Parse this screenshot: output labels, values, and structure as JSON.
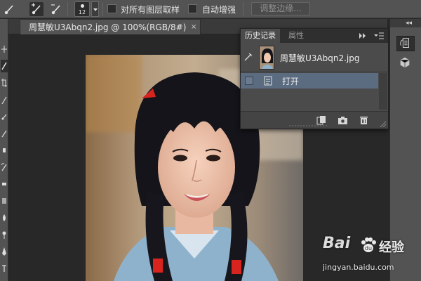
{
  "options_bar": {
    "tool_presets": [
      "brush-tool-icon",
      "brush-tool-plus-icon",
      "brush-tool-minus-icon"
    ],
    "brush_size": "12",
    "sample_all_layers_label": "对所有图层取样",
    "sample_all_layers_checked": false,
    "auto_enhance_label": "自动增强",
    "auto_enhance_checked": false,
    "refine_edge_label": "调整边缘...",
    "refine_edge_enabled": false
  },
  "document": {
    "tab_title": "周慧敏U3Abqn2.jpg @ 100%(RGB/8#)",
    "close_glyph": "×"
  },
  "history_panel": {
    "tabs": [
      {
        "label": "历史记录",
        "active": true
      },
      {
        "label": "属性",
        "active": false
      }
    ],
    "expand_glyph": "▸▸",
    "snapshot_label": "周慧敏U3Abqn2.jpg",
    "states": [
      {
        "label": "打开",
        "selected": true
      }
    ],
    "footer_buttons": [
      "new-document-from-state-icon",
      "camera-icon",
      "trash-icon"
    ]
  },
  "right_dock": {
    "collapse_glyph": "◂◂",
    "buttons": [
      "history-icon",
      "cube-icon"
    ]
  },
  "watermark": {
    "logo_left": "Bai",
    "logo_right": "经验",
    "url": "jingyan.baidu.com"
  },
  "colors": {
    "ui_dark": "#282828",
    "ui_mid": "#535353",
    "panel": "#4b4b4b",
    "selection": "#5b6b80"
  }
}
